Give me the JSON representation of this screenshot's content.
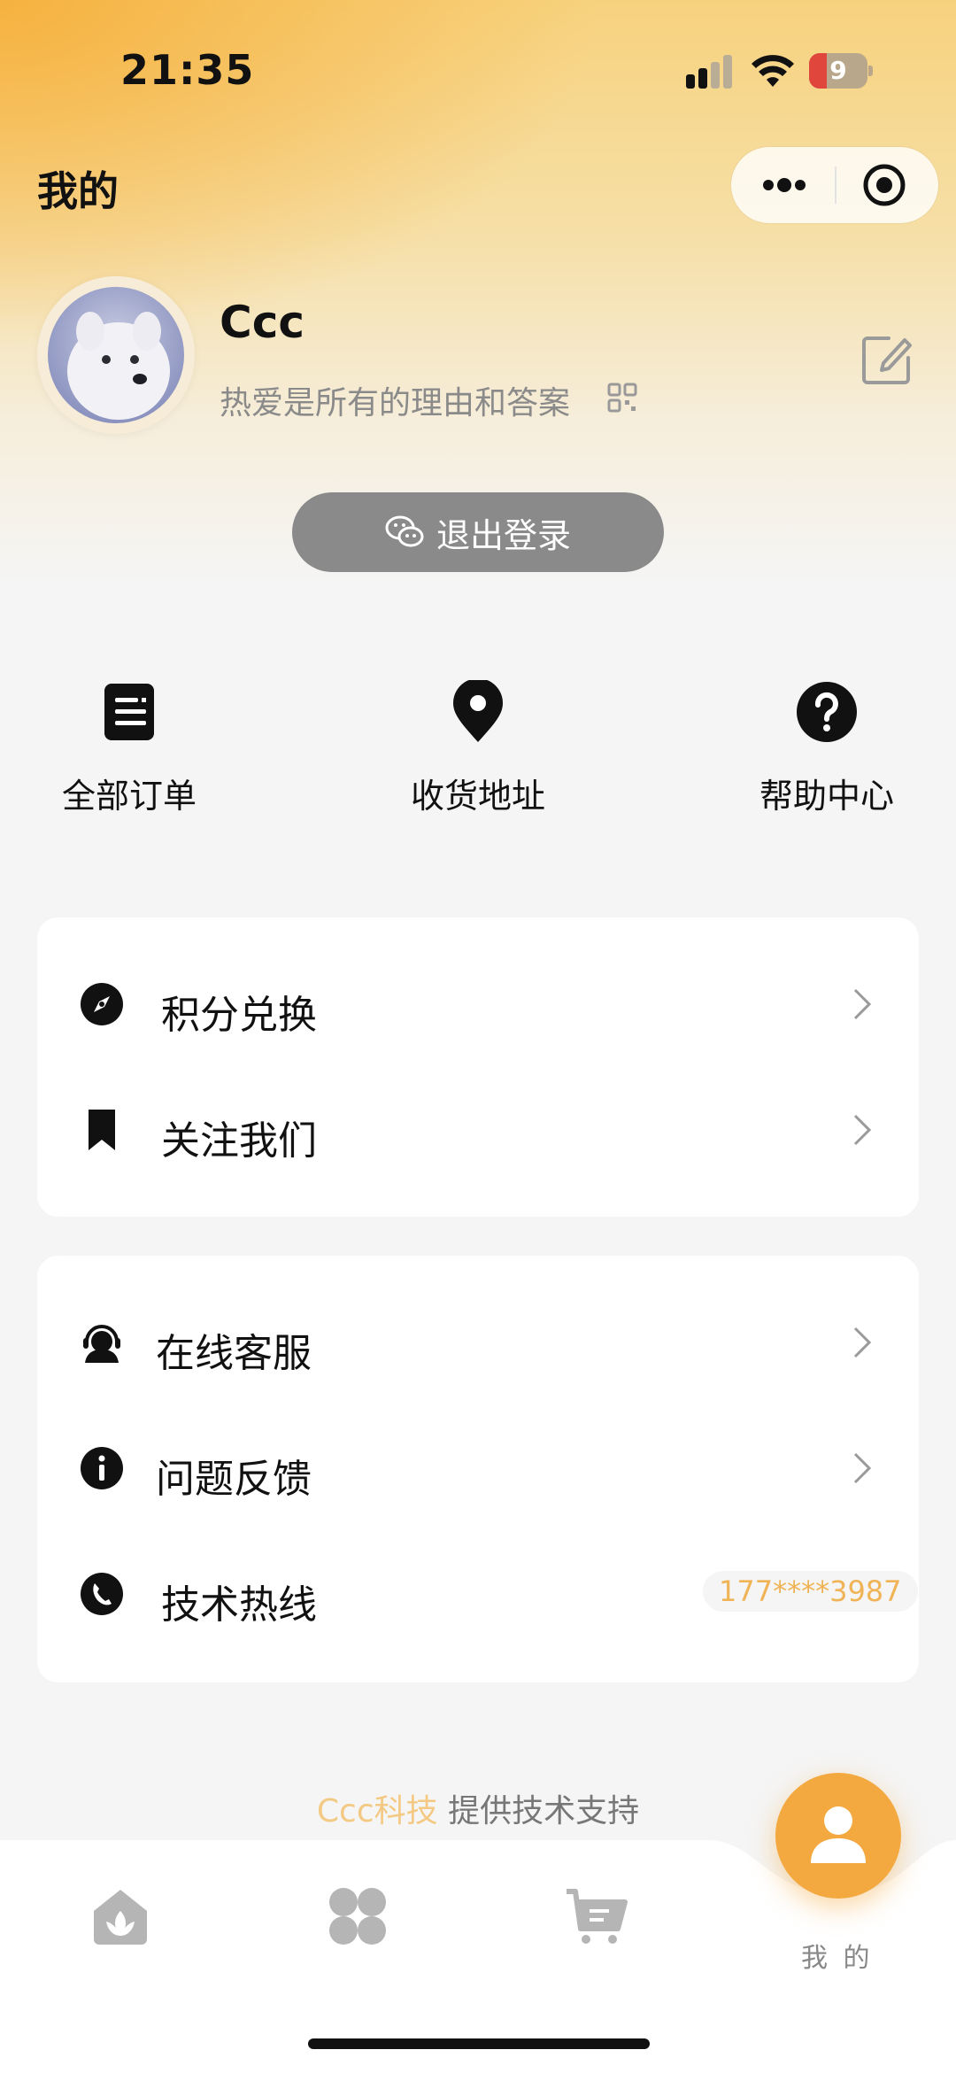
{
  "status_bar": {
    "time": "21:35",
    "battery": "9"
  },
  "header": {
    "title": "我的"
  },
  "profile": {
    "username": "Ccc",
    "signature": "热爱是所有的理由和答案",
    "logout_label": "退出登录"
  },
  "quick_links": [
    {
      "label": "全部订单",
      "icon": "order-list-icon"
    },
    {
      "label": "收货地址",
      "icon": "location-pin-icon"
    },
    {
      "label": "帮助中心",
      "icon": "help-icon"
    }
  ],
  "menu_group_1": [
    {
      "label": "积分兑换",
      "icon": "compass-icon"
    },
    {
      "label": "关注我们",
      "icon": "bookmark-icon"
    }
  ],
  "menu_group_2": [
    {
      "label": "在线客服",
      "icon": "customer-service-icon"
    },
    {
      "label": "问题反馈",
      "icon": "info-icon"
    },
    {
      "label": "技术热线",
      "icon": "phone-icon",
      "value": "177****3987"
    }
  ],
  "footer": {
    "brand": "Ccc科技",
    "text": " 提供技术支持"
  },
  "tabbar": {
    "items": [
      "home-icon",
      "categories-icon",
      "cart-icon"
    ],
    "active_label": "我 的"
  },
  "colors": {
    "accent": "#f3a93f",
    "hotline": "#f0b456",
    "logout_bg": "#8a8a8a"
  }
}
